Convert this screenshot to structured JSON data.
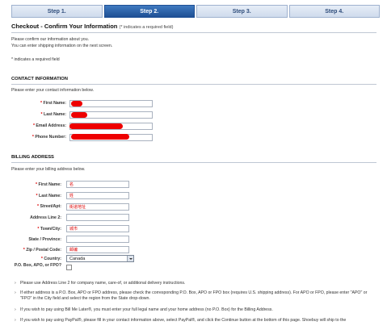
{
  "steps": [
    "Step 1.",
    "Step 2.",
    "Step 3.",
    "Step 4."
  ],
  "page": {
    "title": "Checkout - Confirm Your Information",
    "title_note": "(* indicates a required field)",
    "intro1": "Please confirm our information about you.",
    "intro2": "You can enter shipping information on the next screen.",
    "required_note": "* indicates a required field"
  },
  "contact": {
    "heading": "CONTACT INFORMATION",
    "prompt": "Please enter your contact information below.",
    "labels": [
      "First Name:",
      "Last Name:",
      "Email Address:",
      "Phone Number:"
    ]
  },
  "billing": {
    "heading": "BILLING ADDRESS",
    "prompt": "Please enter your billing address below.",
    "labels": [
      "First Name:",
      "Last Name:",
      "Street/Apt:",
      "Address Line 2:",
      "Town/City:",
      "State / Province:",
      "Zip / Postal Code:",
      "Country:",
      "P.O. Box, APO, or FPO?"
    ],
    "values": [
      "名",
      "姓",
      "街道地址",
      "",
      "城市",
      "",
      "邮编"
    ],
    "country": "Canada"
  },
  "notes": [
    "Please use Address Line 2 for company name, care-of, or additional delivery instructions.",
    "If either address is a P.O. Box, APO or FPO address, please check the corresponding P.O. Box, APO or FPO box (requires U.S. shipping address). For APO or FPO, please enter \"APO\" or \"FPO\" in the City field and select the region from the State drop-down.",
    "If you wish to pay using Bill Me Later®, you must enter your full legal name and your home address (no P.O. Box) for the Billing Address.",
    "If you wish to pay using PayPal®, please fill in your contact information above, select PayPal®, and click the Continue button at the bottom of this page. Shoebuy will ship to the"
  ],
  "colors": {
    "redaction": "#e00000",
    "accent": "#1e4f94",
    "required": "#dd0000"
  }
}
